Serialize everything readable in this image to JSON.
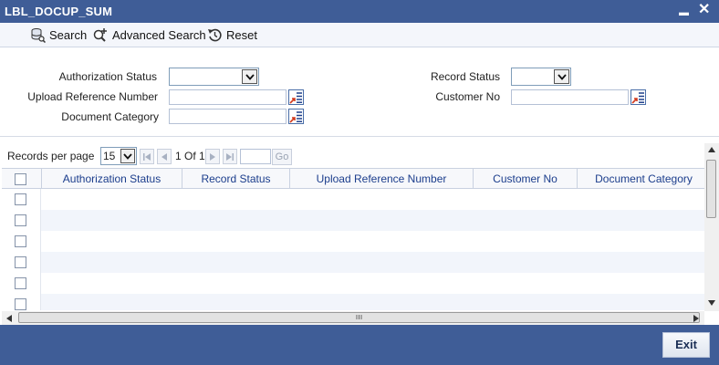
{
  "window": {
    "title": "LBL_DOCUP_SUM",
    "minimize": "▬",
    "close": "✕"
  },
  "toolbar": {
    "search_label": "Search",
    "advanced_search_label": "Advanced Search",
    "reset_label": "Reset"
  },
  "form": {
    "authorization_status_label": "Authorization Status",
    "upload_reference_number_label": "Upload Reference Number",
    "document_category_label": "Document Category",
    "record_status_label": "Record Status",
    "customer_no_label": "Customer No",
    "authorization_status_value": "",
    "record_status_value": "",
    "upload_reference_number_value": "",
    "document_category_value": "",
    "customer_no_value": ""
  },
  "pager": {
    "records_per_page_label": "Records per page",
    "records_per_page_value": "15",
    "page_info": "1 Of 1",
    "go_label": "Go"
  },
  "grid": {
    "columns": [
      "Authorization Status",
      "Record Status",
      "Upload Reference Number",
      "Customer No",
      "Document Category"
    ]
  },
  "footer": {
    "exit_label": "Exit"
  },
  "colors": {
    "title_bar": "#3f5d97",
    "header_text": "#1b3d8c",
    "alt_row": "#f2f5fb"
  }
}
